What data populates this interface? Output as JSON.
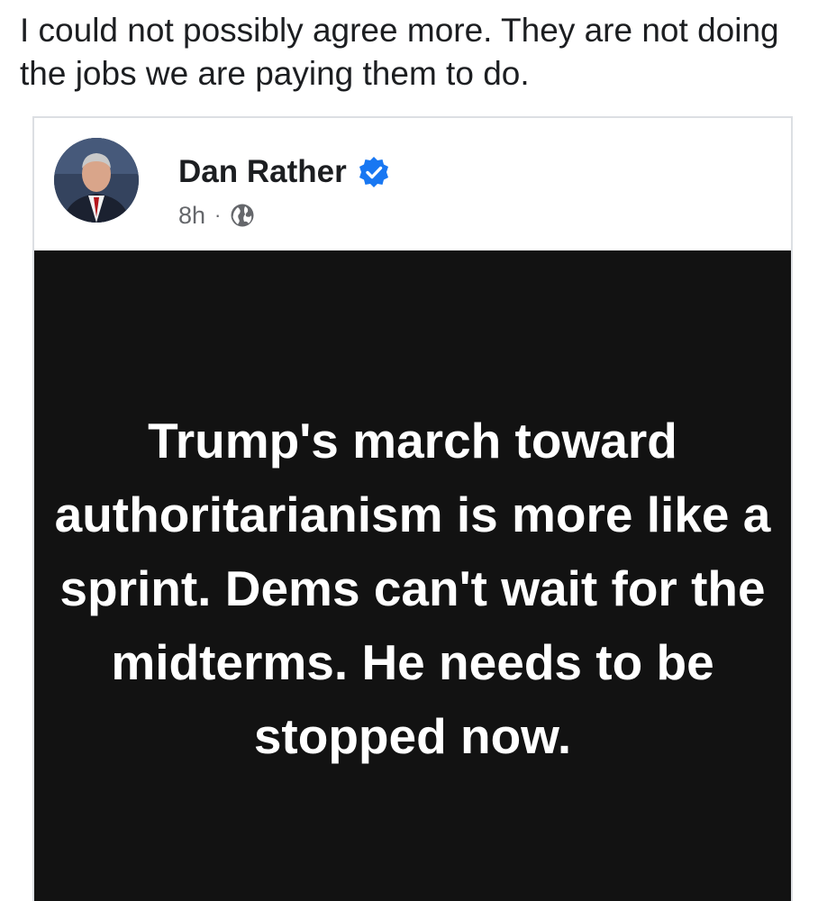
{
  "comment": {
    "text": "I could not possibly agree more. They are not doing the jobs we are paying them to do."
  },
  "shared_post": {
    "author_name": "Dan Rather",
    "verified": true,
    "timestamp": "8h",
    "separator": "·",
    "audience_icon": "globe-icon",
    "quote_text": "Trump's march toward authoritarianism is more like a sprint. Dems can't wait for the midterms. He needs to be stopped now."
  },
  "colors": {
    "verified_blue": "#1877f2",
    "image_background": "#121212",
    "meta_gray": "#65676b",
    "text_dark": "#1c1e21"
  }
}
